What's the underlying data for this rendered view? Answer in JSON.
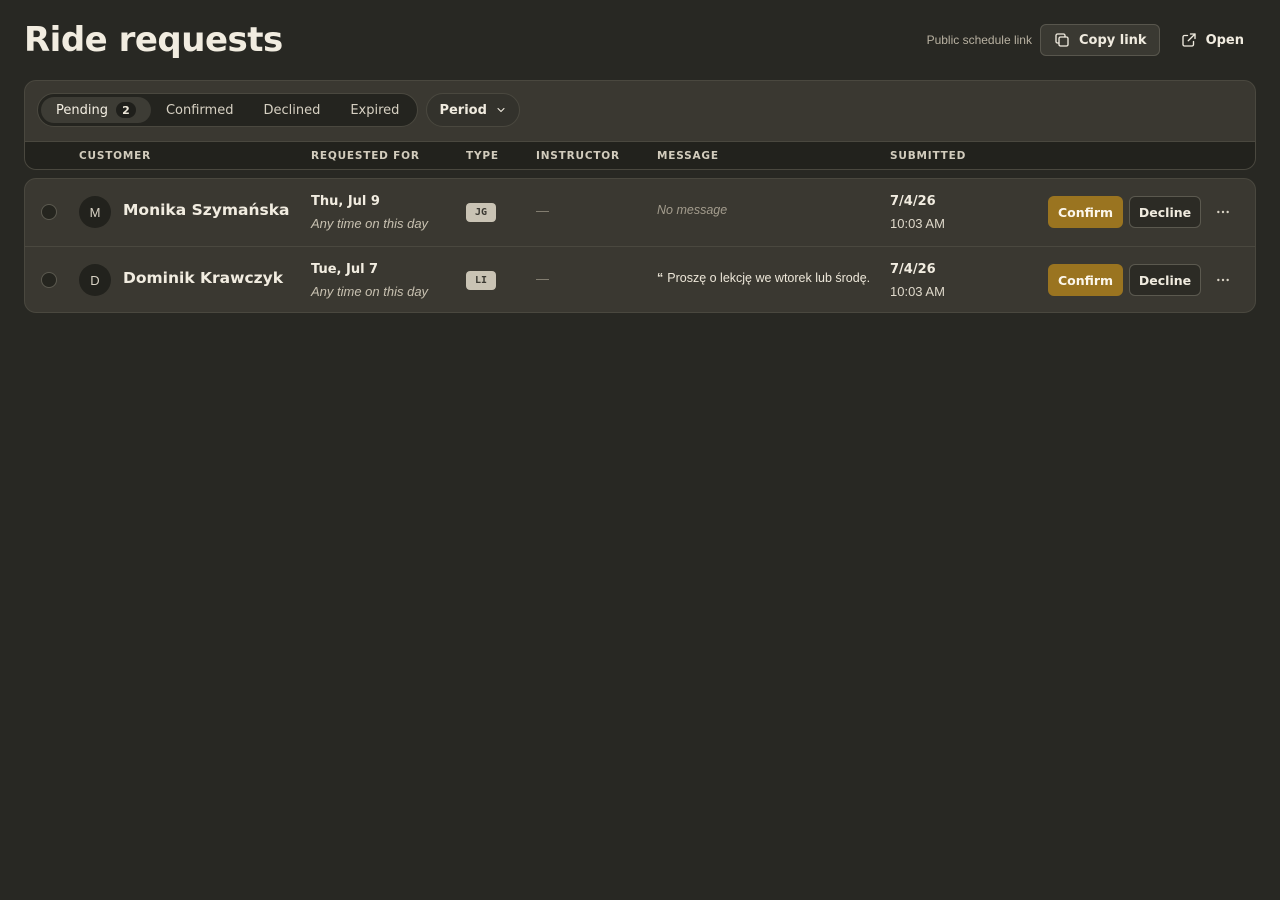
{
  "page": {
    "title": "Ride requests"
  },
  "header": {
    "share_label": "Public schedule link",
    "copy_label": "Copy link",
    "open_label": "Open"
  },
  "filters": {
    "tabs": [
      {
        "label": "Pending",
        "count": "2",
        "active": true
      },
      {
        "label": "Confirmed"
      },
      {
        "label": "Declined"
      },
      {
        "label": "Expired"
      }
    ],
    "period_label": "Period"
  },
  "table": {
    "columns": {
      "customer": "CUSTOMER",
      "requested_for": "REQUESTED FOR",
      "type": "TYPE",
      "instructor": "INSTRUCTOR",
      "message": "MESSAGE",
      "submitted": "SUBMITTED"
    },
    "rows": [
      {
        "initial": "M",
        "name": "Monika Szymańska",
        "date": "Thu, Jul 9",
        "time": "Any time on this day",
        "type": "JG",
        "instructor": "—",
        "message": "No message",
        "submitted_date": "7/4/26",
        "submitted_time": "10:03 AM"
      },
      {
        "initial": "D",
        "name": "Dominik Krawczyk",
        "date": "Tue, Jul 7",
        "time": "Any time on this day",
        "type": "LI",
        "instructor": "—",
        "message": "Proszę o lekcję we wtorek lub środę.",
        "submitted_date": "7/4/26",
        "submitted_time": "10:03 AM"
      }
    ],
    "confirm_label": "Confirm",
    "decline_label": "Decline"
  },
  "colors": {
    "background": "#282823",
    "accent": "#9a7420",
    "card": "#3a3831"
  },
  "icons": {
    "copy": "copy-icon",
    "open": "external-link-icon",
    "period": "chevron-down-icon",
    "more": "more-horizontal-icon"
  }
}
